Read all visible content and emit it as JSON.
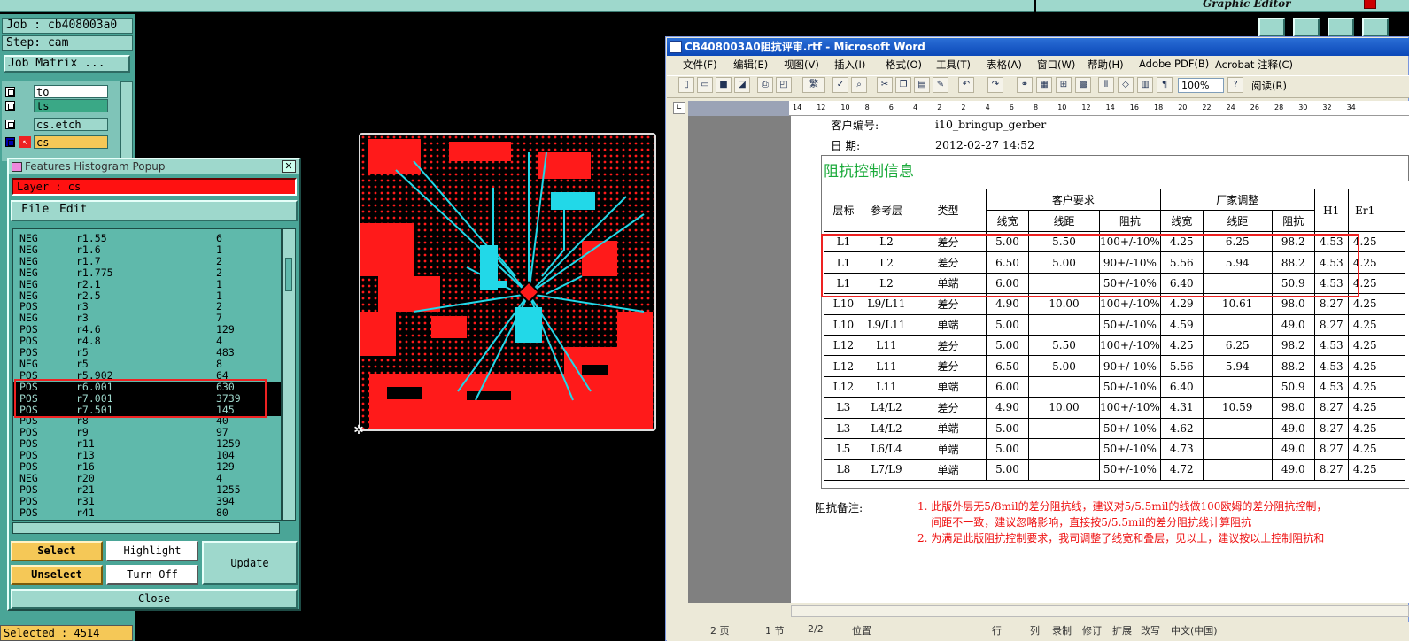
{
  "cam": {
    "graphic_editor_title": "Graphic Editor",
    "job_label": "Job : cb408003a0",
    "step_label": "Step: cam",
    "job_matrix_label": "Job Matrix ...",
    "layers": [
      {
        "name": "to",
        "color": "#ffffff"
      },
      {
        "name": "ts",
        "color": "#3aa886"
      },
      {
        "name": "cs.etch",
        "color": "#9ed8cc"
      },
      {
        "name": "cs",
        "color": "#f5c857"
      }
    ],
    "selected_label": "Selected : 4514"
  },
  "histogram": {
    "title": "Features Histogram Popup",
    "layer_field": "Layer :  cs",
    "menu": {
      "file": "File",
      "edit": "Edit"
    },
    "rows": [
      {
        "pol": "NEG",
        "sym": "r1.55",
        "count": "6"
      },
      {
        "pol": "NEG",
        "sym": "r1.6",
        "count": "1"
      },
      {
        "pol": "NEG",
        "sym": "r1.7",
        "count": "2"
      },
      {
        "pol": "NEG",
        "sym": "r1.775",
        "count": "2"
      },
      {
        "pol": "NEG",
        "sym": "r2.1",
        "count": "1"
      },
      {
        "pol": "NEG",
        "sym": "r2.5",
        "count": "1"
      },
      {
        "pol": "POS",
        "sym": "r3",
        "count": "2"
      },
      {
        "pol": "NEG",
        "sym": "r3",
        "count": "7"
      },
      {
        "pol": "POS",
        "sym": "r4.6",
        "count": "129"
      },
      {
        "pol": "POS",
        "sym": "r4.8",
        "count": "4"
      },
      {
        "pol": "POS",
        "sym": "r5",
        "count": "483"
      },
      {
        "pol": "NEG",
        "sym": "r5",
        "count": "8"
      },
      {
        "pol": "POS",
        "sym": "r5.902",
        "count": "64"
      },
      {
        "pol": "POS",
        "sym": "r6.001",
        "count": "630"
      },
      {
        "pol": "POS",
        "sym": "r7.001",
        "count": "3739"
      },
      {
        "pol": "POS",
        "sym": "r7.501",
        "count": "145"
      },
      {
        "pol": "POS",
        "sym": "r8",
        "count": "40"
      },
      {
        "pol": "POS",
        "sym": "r9",
        "count": "97"
      },
      {
        "pol": "POS",
        "sym": "r11",
        "count": "1259"
      },
      {
        "pol": "POS",
        "sym": "r13",
        "count": "104"
      },
      {
        "pol": "POS",
        "sym": "r16",
        "count": "129"
      },
      {
        "pol": "NEG",
        "sym": "r20",
        "count": "4"
      },
      {
        "pol": "POS",
        "sym": "r21",
        "count": "1255"
      },
      {
        "pol": "POS",
        "sym": "r31",
        "count": "394"
      },
      {
        "pol": "POS",
        "sym": "r41",
        "count": "80"
      }
    ],
    "buttons": {
      "select": "Select",
      "highlight": "Highlight",
      "update": "Update",
      "unselect": "Unselect",
      "turn_off": "Turn Off",
      "close": "Close"
    }
  },
  "word": {
    "title": "CB408003A0阻抗评审.rtf - Microsoft Word",
    "menu": [
      "文件(F)",
      "编辑(E)",
      "视图(V)",
      "插入(I)",
      "格式(O)",
      "工具(T)",
      "表格(A)",
      "窗口(W)",
      "帮助(H)",
      "Adobe PDF(B)",
      "Acrobat 注释(C)"
    ],
    "zoom": "100%",
    "read_label": "阅读(R)",
    "trad_label": "繁",
    "ruler_numbers": [
      "14",
      "12",
      "10",
      "8",
      "6",
      "4",
      "2",
      "2",
      "4",
      "6",
      "8",
      "10",
      "12",
      "14",
      "16",
      "18",
      "20",
      "22",
      "24",
      "26",
      "28",
      "30",
      "32",
      "34"
    ],
    "customer_label": "客户编号:",
    "customer_value": "i10_bringup_gerber",
    "date_label": "日    期:",
    "date_value": "2012-02-27 14:52",
    "section_title": "阻抗控制信息",
    "table_headers": {
      "layer": "层标",
      "ref": "参考层",
      "type": "类型",
      "customer": "客户要求",
      "factory": "厂家调整",
      "width": "线宽",
      "spacing": "线距",
      "impedance": "阻抗",
      "h1": "H1",
      "er1": "Er1"
    },
    "table_rows": [
      [
        "L1",
        "L2",
        "差分",
        "5.00",
        "5.50",
        "100+/-10%",
        "4.25",
        "6.25",
        "98.2",
        "4.53",
        "4.25"
      ],
      [
        "L1",
        "L2",
        "差分",
        "6.50",
        "5.00",
        "90+/-10%",
        "5.56",
        "5.94",
        "88.2",
        "4.53",
        "4.25"
      ],
      [
        "L1",
        "L2",
        "单端",
        "6.00",
        "",
        "50+/-10%",
        "6.40",
        "",
        "50.9",
        "4.53",
        "4.25"
      ],
      [
        "L10",
        "L9/L11",
        "差分",
        "4.90",
        "10.00",
        "100+/-10%",
        "4.29",
        "10.61",
        "98.0",
        "8.27",
        "4.25"
      ],
      [
        "L10",
        "L9/L11",
        "单端",
        "5.00",
        "",
        "50+/-10%",
        "4.59",
        "",
        "49.0",
        "8.27",
        "4.25"
      ],
      [
        "L12",
        "L11",
        "差分",
        "5.00",
        "5.50",
        "100+/-10%",
        "4.25",
        "6.25",
        "98.2",
        "4.53",
        "4.25"
      ],
      [
        "L12",
        "L11",
        "差分",
        "6.50",
        "5.00",
        "90+/-10%",
        "5.56",
        "5.94",
        "88.2",
        "4.53",
        "4.25"
      ],
      [
        "L12",
        "L11",
        "单端",
        "6.00",
        "",
        "50+/-10%",
        "6.40",
        "",
        "50.9",
        "4.53",
        "4.25"
      ],
      [
        "L3",
        "L4/L2",
        "差分",
        "4.90",
        "10.00",
        "100+/-10%",
        "4.31",
        "10.59",
        "98.0",
        "8.27",
        "4.25"
      ],
      [
        "L3",
        "L4/L2",
        "单端",
        "5.00",
        "",
        "50+/-10%",
        "4.62",
        "",
        "49.0",
        "8.27",
        "4.25"
      ],
      [
        "L5",
        "L6/L4",
        "单端",
        "5.00",
        "",
        "50+/-10%",
        "4.73",
        "",
        "49.0",
        "8.27",
        "4.25"
      ],
      [
        "L8",
        "L7/L9",
        "单端",
        "5.00",
        "",
        "50+/-10%",
        "4.72",
        "",
        "49.0",
        "8.27",
        "4.25"
      ]
    ],
    "notes_label": "阻抗备注:",
    "notes": [
      "1.  此版外层无5/8mil的差分阻抗线，建议对5/5.5mil的线做100欧姆的差分阻抗控制，",
      "    间距不一致，建议忽略影响，直接按5/5.5mil的差分阻抗线计算阻抗",
      "2.  为满足此版阻抗控制要求，我司调整了线宽和叠层，见以上，建议按以上控制阻抗和"
    ],
    "status": [
      "2 页",
      "1 节",
      "2/2",
      "位置",
      "行",
      "列",
      "录制",
      "修订",
      "扩展",
      "改写",
      "中文(中国)"
    ]
  },
  "colors": {
    "cam_teal": "#4aa597",
    "cam_light": "#9ed8cc",
    "pcb_red": "#ff1a1a",
    "pcb_cyan": "#22d8e8",
    "highlight_red": "#e22222",
    "word_blue": "#0b48b8"
  }
}
